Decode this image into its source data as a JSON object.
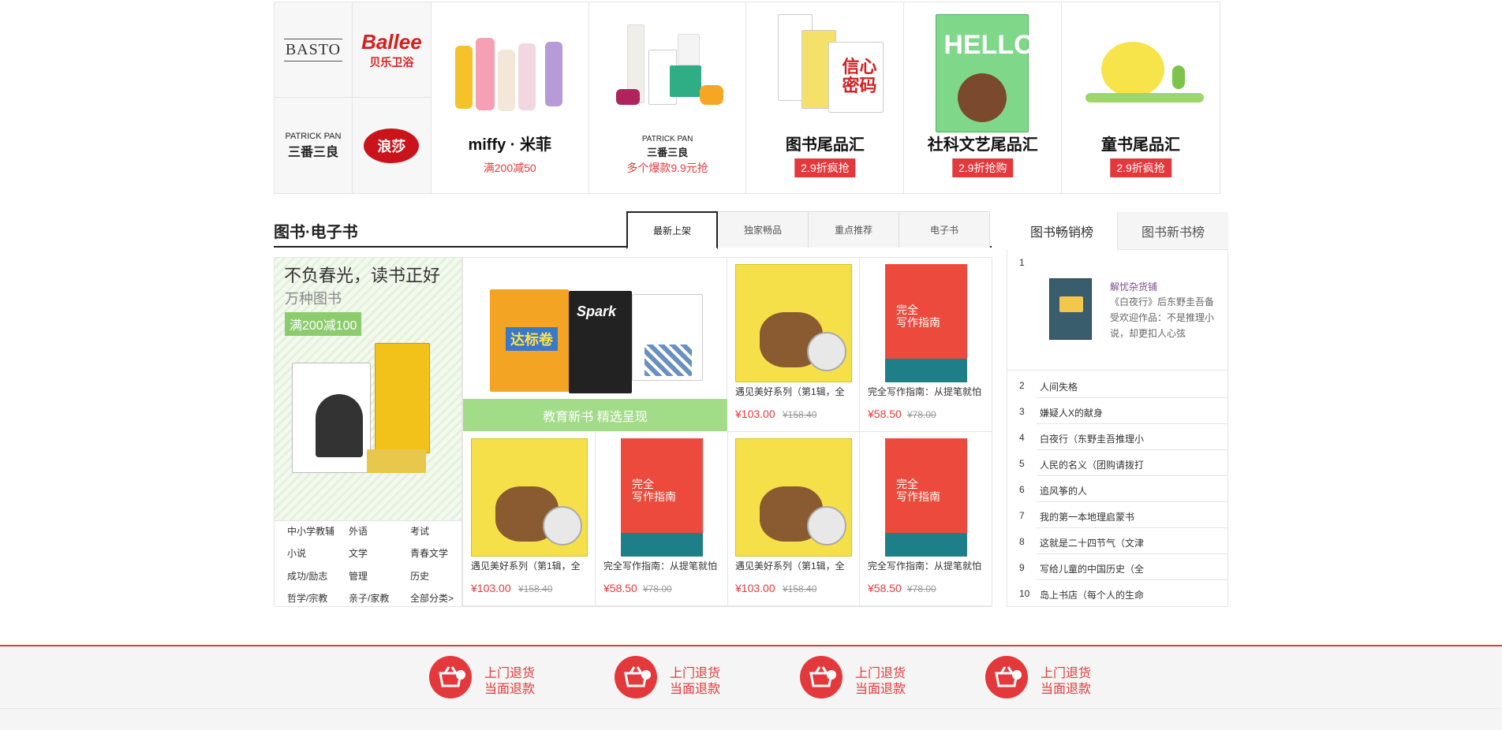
{
  "brands": {
    "logos": [
      "BASTO",
      "Ballee",
      "贝乐卫浴",
      "PATRICK PAN",
      "三番三良",
      "浪莎"
    ],
    "cards": [
      {
        "name": "miffy · 米菲",
        "promo": "满200减50"
      },
      {
        "name_top": "PATRICK PAN",
        "name": "三番三良",
        "promo": "多个爆款9.9元抢"
      },
      {
        "name": "图书尾品汇",
        "pill": "2.9折疯抢"
      },
      {
        "name": "社科文艺尾品汇",
        "pill": "2.9折抢购"
      },
      {
        "name": "童书尾品汇",
        "pill": "2.9折疯抢"
      }
    ]
  },
  "section": {
    "title": "图书·电子书",
    "tabs": [
      "最新上架",
      "独家畅品",
      "重点推荐",
      "电子书"
    ]
  },
  "promo": {
    "headline": "不负春光，读书正好",
    "subhead": "万种图书",
    "badge": "满200减100",
    "categories": [
      "中小学教辅",
      "外语",
      "考试",
      "小说",
      "文学",
      "青春文学",
      "成功/励志",
      "管理",
      "历史",
      "哲学/宗教",
      "亲子/家教",
      "全部分类>"
    ]
  },
  "edu_banner": {
    "label": "教育新书 精选呈现"
  },
  "products": [
    {
      "title": "遇见美好系列（第1辑，全",
      "price": "¥103.00",
      "old": "¥158.40"
    },
    {
      "title": "完全写作指南：从提笔就怕",
      "price": "¥58.50",
      "old": "¥78.00"
    },
    {
      "title": "遇见美好系列（第1辑，全",
      "price": "¥103.00",
      "old": "¥158.40"
    },
    {
      "title": "完全写作指南：从提笔就怕",
      "price": "¥58.50",
      "old": "¥78.00"
    },
    {
      "title": "遇见美好系列（第1辑，全",
      "price": "¥103.00",
      "old": "¥158.40"
    },
    {
      "title": "完全写作指南：从提笔就怕",
      "price": "¥58.50",
      "old": "¥78.00"
    }
  ],
  "ranking": {
    "tabs": [
      "图书畅销榜",
      "图书新书榜"
    ],
    "top": {
      "num": "1",
      "title": "解忧杂货铺",
      "desc": "《白夜行》后东野圭吾备受欢迎作品：不是推理小说，却更扣人心弦"
    },
    "items": [
      {
        "num": "2",
        "title": "人间失格"
      },
      {
        "num": "3",
        "title": "嫌疑人X的献身"
      },
      {
        "num": "4",
        "title": "白夜行（东野圭吾推理小"
      },
      {
        "num": "5",
        "title": "人民的名义（团购请拨打"
      },
      {
        "num": "6",
        "title": "追风筝的人"
      },
      {
        "num": "7",
        "title": "我的第一本地理启蒙书"
      },
      {
        "num": "8",
        "title": "这就是二十四节气（文津"
      },
      {
        "num": "9",
        "title": "写给儿童的中国历史（全"
      },
      {
        "num": "10",
        "title": "岛上书店（每个人的生命"
      }
    ]
  },
  "footer": {
    "items": [
      {
        "l1": "上门退货",
        "l2": "当面退款"
      },
      {
        "l1": "上门退货",
        "l2": "当面退款"
      },
      {
        "l1": "上门退货",
        "l2": "当面退款"
      },
      {
        "l1": "上门退货",
        "l2": "当面退款"
      }
    ]
  },
  "colors": {
    "accent": "#e4393c",
    "green": "#a3dc88"
  }
}
